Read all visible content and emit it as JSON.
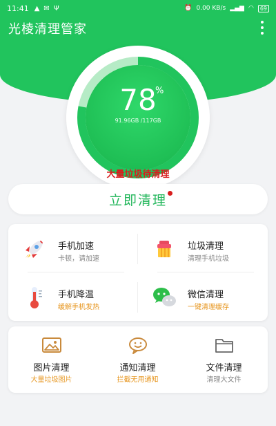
{
  "status_bar": {
    "time": "11:41",
    "network_speed": "0.00 KB/s",
    "battery": "69"
  },
  "app": {
    "title": "光棱清理管家"
  },
  "gauge": {
    "percent": "78",
    "percent_sign": "%",
    "storage": "91.96GB /117GB",
    "fill_fraction": 0.78
  },
  "warning": "大量垃圾待清理",
  "clean_button": "立即清理",
  "tools": [
    {
      "name": "手机加速",
      "desc": "卡顿，请加速",
      "icon": "rocket-icon"
    },
    {
      "name": "垃圾清理",
      "desc": "清理手机垃圾",
      "icon": "trash-icon"
    },
    {
      "name": "手机降温",
      "desc": "缓解手机发热",
      "icon": "thermometer-icon"
    },
    {
      "name": "微信清理",
      "desc": "一键清理缓存",
      "icon": "wechat-icon"
    }
  ],
  "features": [
    {
      "name": "图片清理",
      "desc": "大量垃圾图片",
      "icon": "image-icon"
    },
    {
      "name": "通知清理",
      "desc": "拦截无用通知",
      "icon": "chat-smile-icon"
    },
    {
      "name": "文件清理",
      "desc": "清理大文件",
      "icon": "folder-icon"
    }
  ],
  "colors": {
    "primary": "#21c45d",
    "warning": "#d81e1e",
    "accent": "#e7961f"
  }
}
